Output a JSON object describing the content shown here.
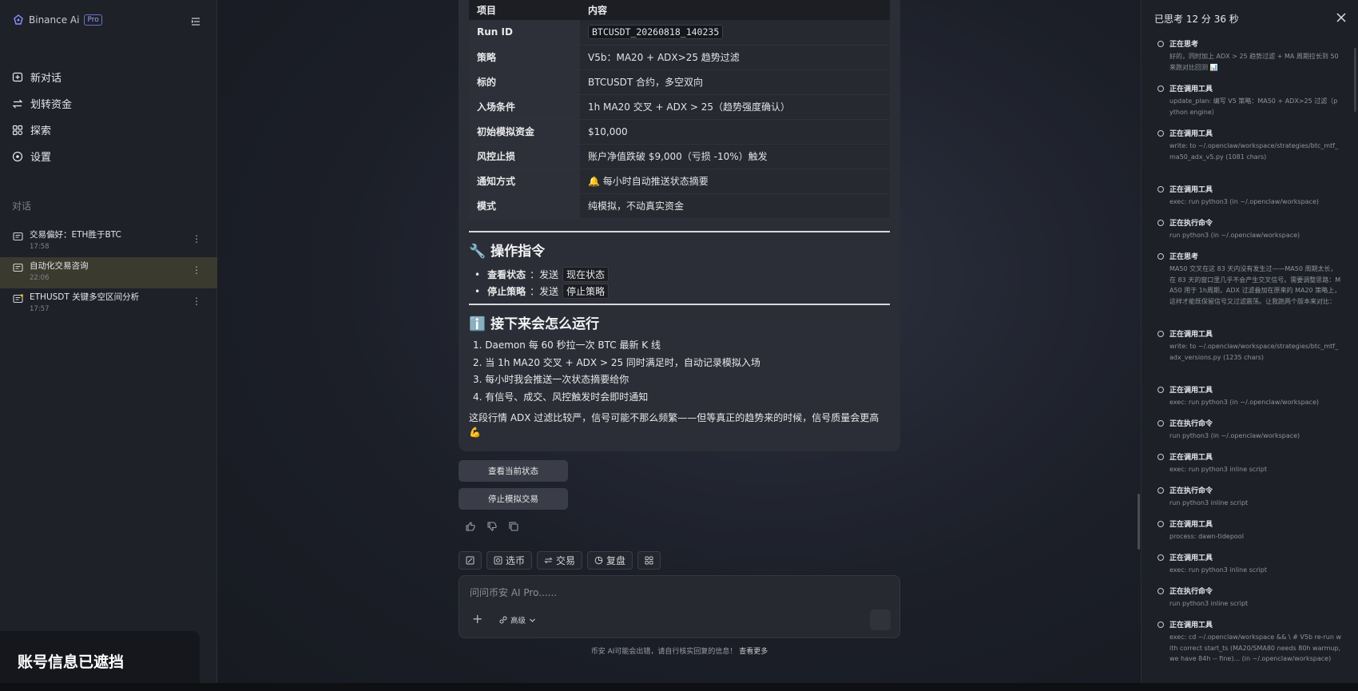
{
  "brand": {
    "name": "Binance Ai",
    "badge": "Pro"
  },
  "nav": [
    {
      "label": "新对话",
      "icon": "new-chat-icon"
    },
    {
      "label": "划转资金",
      "icon": "transfer-icon"
    },
    {
      "label": "探索",
      "icon": "explore-icon"
    },
    {
      "label": "设置",
      "icon": "settings-icon"
    }
  ],
  "conversations_label": "对话",
  "conversations": [
    {
      "title": "交易偏好：ETH胜于BTC",
      "time": "17:58"
    },
    {
      "title": "自动化交易咨询",
      "time": "22:06",
      "active": true
    },
    {
      "title": "ETHUSDT 关键多空区间分析",
      "time": "17:57"
    }
  ],
  "masked_notice": "账号信息已遮挡",
  "table": {
    "headers": [
      "项目",
      "内容"
    ],
    "rows": [
      {
        "k": "Run ID",
        "v": "BTCUSDT_20260818_140235"
      },
      {
        "k": "策略",
        "v": "V5b：MA20 + ADX>25 趋势过滤"
      },
      {
        "k": "标的",
        "v": "BTCUSDT 合约，多空双向"
      },
      {
        "k": "入场条件",
        "v": "1h MA20 交叉 + ADX > 25（趋势强度确认）"
      },
      {
        "k": "初始模拟资金",
        "v": "$10,000"
      },
      {
        "k": "风控止损",
        "v": "账户净值跌破 $9,000（亏损 -10%）触发"
      },
      {
        "k": "通知方式",
        "v": "🔔 每小时自动推送状态摘要"
      },
      {
        "k": "模式",
        "v": "纯模拟，不动真实资金"
      }
    ]
  },
  "ops": {
    "heading": "🔧 操作指令",
    "items": [
      {
        "label": "查看状态",
        "verb": "：发送",
        "cmd": "现在状态"
      },
      {
        "label": "停止策略",
        "verb": "：发送",
        "cmd": "停止策略"
      }
    ]
  },
  "next": {
    "heading": "ℹ️ 接下来会怎么运行",
    "steps": [
      "1. Daemon 每 60 秒拉一次 BTC 最新 K 线",
      "2. 当 1h MA20 交叉 + ADX > 25 同时满足时，自动记录模拟入场",
      "3. 每小时我会推送一次状态摘要给你",
      "4. 有信号、成交、风控触发时会即时通知"
    ],
    "para": "这段行情 ADX 过滤比较严，信号可能不那么频繁——但等真正的趋势来的时候，信号质量会更高 💪"
  },
  "actions": {
    "status": "查看当前状态",
    "stop": "停止模拟交易"
  },
  "toolbar": [
    {
      "label": "",
      "icon": "edit-icon"
    },
    {
      "label": "选币",
      "icon": "coin-select-icon"
    },
    {
      "label": "交易",
      "icon": "trade-icon"
    },
    {
      "label": "复盘",
      "icon": "review-icon"
    },
    {
      "label": "",
      "icon": "apps-icon"
    }
  ],
  "composer": {
    "placeholder": "问问币安 AI Pro......",
    "advanced": "高级"
  },
  "disclaimer": {
    "text": "币安 AI可能会出错，请自行核实回复的信息！",
    "link": "查看更多"
  },
  "panel": {
    "title": "已思考 12 分 36 秒",
    "steps": [
      {
        "t": "正在思考",
        "d": "好的，同时加上 ADX > 25 趋势过滤 + MA 周期拉长到 50 来跑对比回测 📊"
      },
      {
        "t": "正在调用工具",
        "d": "update_plan: 编写 V5 策略：MA50 + ADX>25 过滤（python engine）"
      },
      {
        "t": "正在调用工具",
        "d": "write: to ~/.openclaw/workspace/strategies/btc_mtf_ma50_adx_v5.py (1081 chars)"
      },
      {
        "t": "正在调用工具",
        "d": "exec: run python3 (in ~/.openclaw/workspace)"
      },
      {
        "t": "正在执行命令",
        "d": "run python3 (in ~/.openclaw/workspace)"
      },
      {
        "t": "正在思考",
        "d": "MA50 交叉在这 83 天内没有发生过——MA50 周期太长，在 83 天的窗口里几乎不会产生交叉信号。需要调整思路：MA50 用于 1h周期，ADX 过滤叠加在原来的 MA20 策略上，这样才能既保留信号又过滤震荡。让我跑两个版本来对比："
      },
      {
        "t": "正在调用工具",
        "d": "write: to ~/.openclaw/workspace/strategies/btc_mtf_adx_versions.py (1235 chars)"
      },
      {
        "t": "正在调用工具",
        "d": "exec: run python3 (in ~/.openclaw/workspace)"
      },
      {
        "t": "正在执行命令",
        "d": "run python3 (in ~/.openclaw/workspace)"
      },
      {
        "t": "正在调用工具",
        "d": "exec: run python3 inline script"
      },
      {
        "t": "正在执行命令",
        "d": "run python3 inline script"
      },
      {
        "t": "正在调用工具",
        "d": "process: dawn-tidepool"
      },
      {
        "t": "正在调用工具",
        "d": "exec: run python3 inline script"
      },
      {
        "t": "正在执行命令",
        "d": "run python3 inline script"
      },
      {
        "t": "正在调用工具",
        "d": "exec: cd ~/.openclaw/workspace && \\ # V5b re-run with correct start_ts (MA20/SMA80 needs 80h warmup, we have 84h -- fine)... (in ~/.openclaw/workspace)"
      }
    ]
  }
}
